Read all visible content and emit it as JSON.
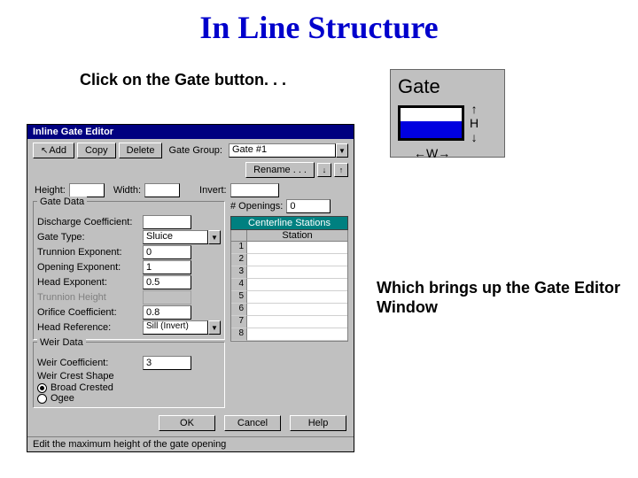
{
  "slide_title": "In Line Structure",
  "caption_top": "Click on the Gate button. . .",
  "caption_right": "Which brings up the Gate Editor Window",
  "gate_icon": {
    "label": "Gate",
    "h_label": "H",
    "w_label": "W"
  },
  "dialog": {
    "title": "Inline Gate Editor",
    "toolbar": {
      "add": "Add",
      "copy": "Copy",
      "delete": "Delete",
      "gate_group_label": "Gate Group:",
      "gate_group_value": "Gate #1",
      "rename": "Rename . . .",
      "up_arrow": "↑",
      "down_arrow": "↓"
    },
    "height_label": "Height:",
    "height_value": "",
    "width_label": "Width:",
    "width_value": "",
    "invert_label": "Invert:",
    "invert_value": "",
    "openings_label": "# Openings:",
    "openings_value": "0",
    "gate_data_group": "Gate Data",
    "discharge_coef_label": "Discharge Coefficient:",
    "discharge_coef_value": "",
    "gate_type_label": "Gate Type:",
    "gate_type_value": "Sluice",
    "trunnion_exp_label": "Trunnion Exponent:",
    "trunnion_exp_value": "0",
    "opening_exp_label": "Opening Exponent:",
    "opening_exp_value": "1",
    "head_exp_label": "Head Exponent:",
    "head_exp_value": "0.5",
    "trunnion_height_label": "Trunnion Height",
    "orifice_coef_label": "Orifice Coefficient:",
    "orifice_coef_value": "0.8",
    "head_ref_label": "Head Reference:",
    "head_ref_value": "Sill (Invert)",
    "weir_data_group": "Weir Data",
    "weir_coef_label": "Weir Coefficient:",
    "weir_coef_value": "3",
    "weir_shape_label": "Weir Crest Shape",
    "radio_broad": "Broad Crested",
    "radio_ogee": "Ogee",
    "stations_header": "Centerline Stations",
    "stations_col": "Station",
    "stations_rows": [
      "1",
      "2",
      "3",
      "4",
      "5",
      "6",
      "7",
      "8"
    ],
    "ok": "OK",
    "cancel": "Cancel",
    "help": "Help",
    "status": "Edit the maximum height of the gate opening"
  }
}
